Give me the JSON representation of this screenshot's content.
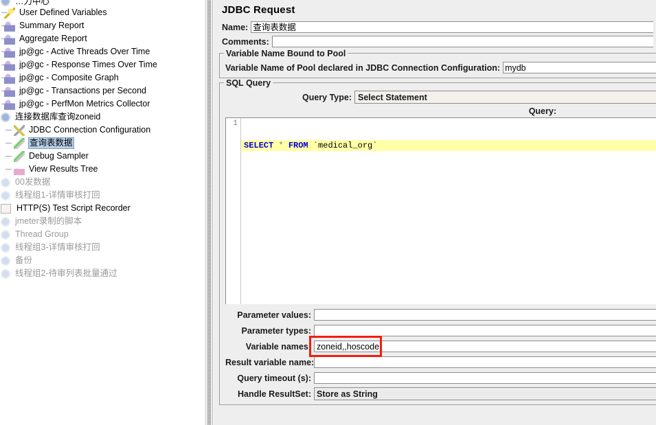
{
  "tree": {
    "items": [
      {
        "label": "…力中心",
        "icon": "threadgroup-icon",
        "indent": 0,
        "state": "clipped",
        "connector": false
      },
      {
        "label": "User Defined Variables",
        "icon": "user-defined-variables-icon",
        "indent": 1,
        "state": "normal",
        "connector": true
      },
      {
        "label": "Summary Report",
        "icon": "summary-report-icon",
        "indent": 1,
        "state": "normal",
        "connector": true
      },
      {
        "label": "Aggregate Report",
        "icon": "aggregate-report-icon",
        "indent": 1,
        "state": "normal",
        "connector": true
      },
      {
        "label": "jp@gc - Active Threads Over Time",
        "icon": "listener-icon",
        "indent": 1,
        "state": "normal",
        "connector": true
      },
      {
        "label": "jp@gc - Response Times Over Time",
        "icon": "listener-icon",
        "indent": 1,
        "state": "normal",
        "connector": true
      },
      {
        "label": "jp@gc - Composite Graph",
        "icon": "listener-icon",
        "indent": 1,
        "state": "normal",
        "connector": true
      },
      {
        "label": "jp@gc - Transactions per Second",
        "icon": "listener-icon",
        "indent": 1,
        "state": "normal",
        "connector": true
      },
      {
        "label": "jp@gc - PerfMon Metrics Collector",
        "icon": "listener-icon",
        "indent": 1,
        "state": "normal",
        "connector": true
      },
      {
        "label": "连接数据库查询zoneid",
        "icon": "thread-group-icon",
        "indent": 0,
        "state": "normal",
        "connector": false
      },
      {
        "label": "JDBC Connection Configuration",
        "icon": "jdbc-config-icon",
        "indent": 2,
        "state": "normal",
        "connector": true
      },
      {
        "label": "查询表数据",
        "icon": "jdbc-sampler-icon",
        "indent": 2,
        "state": "selected",
        "connector": true
      },
      {
        "label": "Debug Sampler",
        "icon": "debug-sampler-icon",
        "indent": 2,
        "state": "normal",
        "connector": true
      },
      {
        "label": "View Results Tree",
        "icon": "view-results-tree-icon",
        "indent": 2,
        "state": "normal",
        "connector": true
      },
      {
        "label": "00发数据",
        "icon": "thread-group-icon",
        "indent": 0,
        "state": "disabled",
        "connector": false
      },
      {
        "label": "线程组1-详情审核打回",
        "icon": "thread-group-icon",
        "indent": 0,
        "state": "disabled",
        "connector": false
      },
      {
        "label": "HTTP(S) Test Script Recorder",
        "icon": "http-recorder-icon",
        "indent": 0,
        "state": "normal",
        "connector": false
      },
      {
        "label": "jmeter录制的脚本",
        "icon": "thread-group-icon",
        "indent": 0,
        "state": "disabled",
        "connector": false
      },
      {
        "label": "Thread Group",
        "icon": "thread-group-icon",
        "indent": 0,
        "state": "disabled",
        "connector": false
      },
      {
        "label": "线程组3-详情审核打回",
        "icon": "thread-group-icon",
        "indent": 0,
        "state": "disabled",
        "connector": false
      },
      {
        "label": "备份",
        "icon": "thread-group-icon",
        "indent": 0,
        "state": "disabled",
        "connector": false
      },
      {
        "label": "线程组2-待审列表批量通过",
        "icon": "thread-group-icon",
        "indent": 0,
        "state": "disabled",
        "connector": false
      }
    ]
  },
  "main": {
    "title": "JDBC Request",
    "name_label": "Name:",
    "name_value": "查询表数据",
    "comments_label": "Comments:",
    "comments_value": "",
    "pool_group_title": "Variable Name Bound to Pool",
    "pool_field_label": "Variable Name of Pool declared in JDBC Connection Configuration:",
    "pool_field_value": "mydb",
    "sql_group_title": "SQL Query",
    "query_type_label": "Query Type:",
    "query_type_value": "Select Statement",
    "query_label": "Query:",
    "editor": {
      "line_number": "1",
      "tokens": [
        {
          "text": "SELECT",
          "kind": "kw"
        },
        {
          "text": " ",
          "kind": "plain"
        },
        {
          "text": "*",
          "kind": "op"
        },
        {
          "text": " ",
          "kind": "plain"
        },
        {
          "text": "FROM",
          "kind": "kw"
        },
        {
          "text": " `medical_org`",
          "kind": "ident"
        }
      ],
      "full_text": "SELECT * FROM `medical_org`"
    },
    "fields": [
      {
        "label": "Parameter values:",
        "value": "",
        "kind": "text"
      },
      {
        "label": "Parameter types:",
        "value": "",
        "kind": "text"
      },
      {
        "label": "Variable names:",
        "value": "zoneid,,hoscode",
        "kind": "text",
        "highlighted": true
      },
      {
        "label": "Result variable name:",
        "value": "",
        "kind": "text"
      },
      {
        "label": "Query timeout (s):",
        "value": "",
        "kind": "text"
      },
      {
        "label": "Handle ResultSet:",
        "value": "Store as String",
        "kind": "combo"
      }
    ]
  },
  "colors": {
    "highlight_red": "#f41c0c",
    "selection_blue": "#b8cfe8",
    "editor_current_line": "#ffffa8",
    "keyword_blue": "#0000d0",
    "panel_bg": "#eeeeee"
  }
}
